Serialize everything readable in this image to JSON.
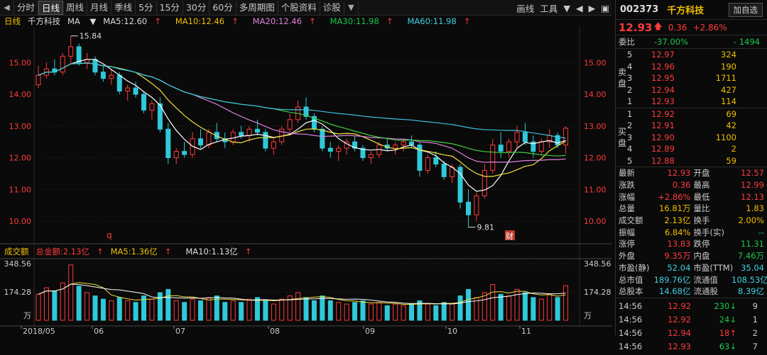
{
  "toolbar": {
    "tabs": [
      "分时",
      "日线",
      "周线",
      "月线",
      "季线",
      "5分",
      "15分",
      "30分",
      "60分",
      "多周期图",
      "个股资料",
      "诊股"
    ],
    "active_tab": "日线",
    "dropdown_arrow": "▼",
    "right": [
      "画线",
      "工具"
    ]
  },
  "stock_bar": {
    "period": "日线",
    "name": "千方科技",
    "indicator": "MA",
    "ma5": "MA5:12.60",
    "ma10": "MA10:12.46",
    "ma20": "MA20:12.46",
    "ma30": "MA30:11.98",
    "ma60": "MA60:11.98"
  },
  "vol_bar": {
    "title": "成交额",
    "total": "总金额:2.13亿",
    "ma5": "MA5:1.36亿",
    "ma10": "MA10:1.13亿"
  },
  "colors": {
    "up": "#ff3b3b",
    "down": "#2fc9d9",
    "ma5": "#ffffff",
    "ma10": "#f0e040",
    "ma20": "#e080e0",
    "ma30": "#40d040",
    "ma60": "#40c0e0"
  },
  "chart_data": {
    "type": "candlestick",
    "price_axis": [
      "15.00",
      "14.00",
      "13.00",
      "12.00",
      "11.00",
      "10.00"
    ],
    "volume_axis": [
      "348.56",
      "174.28",
      "万"
    ],
    "x_labels": [
      "2018/05",
      "06",
      "07",
      "08",
      "09",
      "10",
      "11"
    ],
    "annotations": {
      "high": "15.84",
      "low": "9.81",
      "marker_q": "q",
      "marker_cai": "财"
    },
    "candles": [
      [
        14.3,
        14.9,
        14.2,
        14.6
      ],
      [
        14.6,
        15.0,
        14.5,
        14.8
      ],
      [
        14.8,
        15.1,
        14.6,
        14.7
      ],
      [
        14.7,
        15.3,
        14.6,
        15.2
      ],
      [
        15.2,
        15.84,
        15.0,
        15.5
      ],
      [
        15.5,
        15.6,
        14.9,
        15.0
      ],
      [
        15.0,
        15.3,
        14.8,
        15.1
      ],
      [
        15.1,
        15.2,
        14.6,
        14.7
      ],
      [
        14.7,
        14.9,
        14.4,
        14.5
      ],
      [
        14.5,
        14.8,
        14.3,
        14.6
      ],
      [
        14.6,
        14.7,
        14.0,
        14.1
      ],
      [
        14.1,
        14.3,
        13.8,
        14.2
      ],
      [
        14.2,
        14.4,
        13.9,
        14.0
      ],
      [
        14.0,
        14.1,
        13.4,
        13.5
      ],
      [
        13.5,
        13.8,
        13.2,
        13.7
      ],
      [
        13.7,
        13.9,
        12.8,
        12.9
      ],
      [
        12.9,
        13.1,
        11.8,
        12.0
      ],
      [
        12.0,
        12.3,
        11.8,
        12.2
      ],
      [
        12.2,
        12.5,
        12.0,
        12.1
      ],
      [
        12.1,
        12.8,
        12.0,
        12.6
      ],
      [
        12.6,
        12.9,
        12.3,
        12.4
      ],
      [
        12.4,
        12.9,
        12.3,
        12.8
      ],
      [
        12.8,
        13.1,
        12.5,
        12.6
      ],
      [
        12.6,
        12.8,
        12.3,
        12.5
      ],
      [
        12.5,
        12.9,
        12.4,
        12.8
      ],
      [
        12.8,
        13.0,
        12.6,
        12.7
      ],
      [
        12.7,
        13.0,
        12.5,
        12.9
      ],
      [
        12.9,
        13.2,
        12.7,
        12.8
      ],
      [
        12.8,
        12.9,
        12.2,
        12.3
      ],
      [
        12.3,
        12.6,
        12.1,
        12.5
      ],
      [
        12.5,
        13.0,
        12.4,
        12.9
      ],
      [
        12.9,
        13.4,
        12.8,
        13.2
      ],
      [
        13.2,
        13.8,
        13.1,
        13.6
      ],
      [
        13.6,
        13.9,
        13.2,
        13.3
      ],
      [
        13.3,
        13.4,
        12.8,
        12.9
      ],
      [
        12.9,
        13.0,
        12.2,
        12.3
      ],
      [
        12.3,
        12.5,
        12.0,
        12.2
      ],
      [
        12.2,
        12.4,
        11.9,
        12.3
      ],
      [
        12.3,
        12.6,
        12.1,
        12.5
      ],
      [
        12.5,
        12.7,
        12.2,
        12.3
      ],
      [
        12.3,
        12.4,
        11.9,
        12.0
      ],
      [
        12.0,
        12.2,
        11.8,
        12.1
      ],
      [
        12.1,
        12.5,
        12.0,
        12.4
      ],
      [
        12.4,
        12.6,
        12.2,
        12.3
      ],
      [
        12.3,
        12.5,
        12.1,
        12.4
      ],
      [
        12.4,
        12.6,
        12.2,
        12.5
      ],
      [
        12.5,
        12.7,
        12.3,
        12.4
      ],
      [
        12.4,
        12.5,
        11.4,
        11.6
      ],
      [
        11.6,
        12.1,
        11.5,
        12.0
      ],
      [
        12.0,
        12.2,
        11.7,
        11.8
      ],
      [
        11.8,
        11.9,
        11.3,
        11.4
      ],
      [
        11.4,
        11.8,
        11.2,
        11.7
      ],
      [
        11.7,
        11.8,
        10.4,
        10.6
      ],
      [
        10.6,
        11.0,
        9.81,
        10.2
      ],
      [
        10.2,
        10.9,
        10.0,
        10.8
      ],
      [
        10.8,
        11.8,
        10.7,
        11.6
      ],
      [
        11.6,
        12.6,
        11.5,
        12.4
      ],
      [
        12.4,
        12.8,
        12.0,
        12.2
      ],
      [
        12.2,
        12.6,
        12.0,
        12.5
      ],
      [
        12.5,
        13.0,
        12.3,
        12.8
      ],
      [
        12.8,
        13.1,
        12.4,
        12.5
      ],
      [
        12.5,
        12.7,
        12.0,
        12.2
      ],
      [
        12.2,
        12.6,
        12.1,
        12.5
      ],
      [
        12.5,
        12.9,
        12.3,
        12.7
      ],
      [
        12.7,
        12.8,
        12.3,
        12.4
      ],
      [
        12.4,
        12.99,
        12.13,
        12.93
      ]
    ],
    "volumes": [
      160,
      200,
      180,
      230,
      340,
      210,
      170,
      150,
      130,
      120,
      140,
      120,
      110,
      150,
      130,
      170,
      190,
      120,
      110,
      130,
      120,
      140,
      150,
      110,
      120,
      110,
      130,
      140,
      120,
      100,
      130,
      150,
      170,
      140,
      120,
      150,
      120,
      110,
      100,
      110,
      120,
      100,
      110,
      90,
      100,
      90,
      100,
      120,
      100,
      90,
      110,
      100,
      150,
      190,
      140,
      170,
      220,
      160,
      150,
      190,
      170,
      140,
      130,
      160,
      140,
      213
    ]
  },
  "panel": {
    "code": "002373",
    "name": "千方科技",
    "fav_btn": "加自选",
    "price": "12.93",
    "change": "0.36",
    "change_pct": "+2.86%",
    "wb_label": "委比",
    "wb_pct": "-37.00%",
    "wb_diff": "- 1494",
    "sell_label": "卖盘",
    "buy_label": "买盘",
    "sell": [
      [
        "5",
        "12.97",
        "324"
      ],
      [
        "4",
        "12.96",
        "190"
      ],
      [
        "3",
        "12.95",
        "1711"
      ],
      [
        "2",
        "12.94",
        "427"
      ],
      [
        "1",
        "12.93",
        "114"
      ]
    ],
    "buy": [
      [
        "1",
        "12.92",
        "69"
      ],
      [
        "2",
        "12.91",
        "42"
      ],
      [
        "3",
        "12.90",
        "1100"
      ],
      [
        "4",
        "12.89",
        "2"
      ],
      [
        "5",
        "12.88",
        "59"
      ]
    ],
    "stats": [
      [
        "最新",
        "12.93",
        "开盘",
        "12.57"
      ],
      [
        "涨跌",
        "0.36",
        "最高",
        "12.99"
      ],
      [
        "涨幅",
        "+2.86%",
        "最低",
        "12.13"
      ],
      [
        "总量",
        "16.81万",
        "量比",
        "1.83"
      ],
      [
        "成交额",
        "2.13亿",
        "换手",
        "2.00%"
      ],
      [
        "振幅",
        "6.84%",
        "换手(实)",
        "--"
      ],
      [
        "涨停",
        "13.83",
        "跌停",
        "11.31"
      ],
      [
        "外盘",
        "9.35万",
        "内盘",
        "7.46万"
      ],
      [
        "市盈(静)",
        "52.04",
        "市盈(TTM)",
        "35.04"
      ],
      [
        "总市值",
        "189.76亿",
        "流通值",
        "108.53亿"
      ],
      [
        "总股本",
        "14.68亿",
        "流通股",
        "8.39亿"
      ]
    ],
    "ticks": [
      [
        "14:56",
        "12.92",
        "230",
        "9",
        "down"
      ],
      [
        "14:56",
        "12.92",
        "24",
        "1",
        "down"
      ],
      [
        "14:56",
        "12.94",
        "18",
        "2",
        "up"
      ],
      [
        "14:56",
        "12.93",
        "63",
        "7",
        "down"
      ]
    ]
  }
}
